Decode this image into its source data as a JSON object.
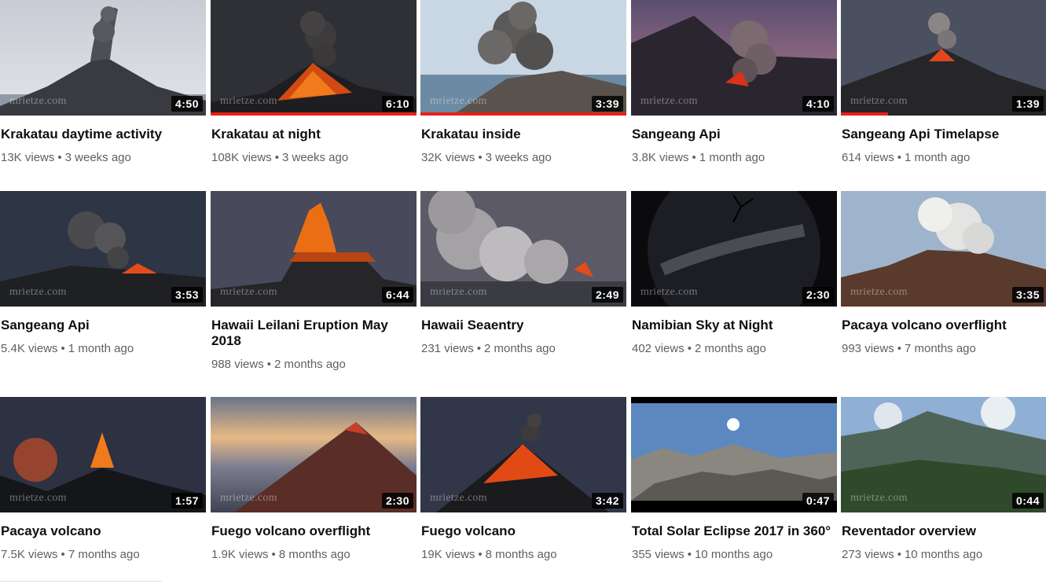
{
  "videos": [
    {
      "title": "Krakatau daytime activity",
      "views": "13K views",
      "age": "3 weeks ago",
      "duration": "4:50",
      "progress": 0,
      "watermark": "mrietze.com"
    },
    {
      "title": "Krakatau at night",
      "views": "108K views",
      "age": "3 weeks ago",
      "duration": "6:10",
      "progress": 1,
      "watermark": "mrietze.com"
    },
    {
      "title": "Krakatau inside",
      "views": "32K views",
      "age": "3 weeks ago",
      "duration": "3:39",
      "progress": 1,
      "watermark": "mrietze.com"
    },
    {
      "title": "Sangeang Api",
      "views": "3.8K views",
      "age": "1 month ago",
      "duration": "4:10",
      "progress": 0,
      "watermark": "mrietze.com"
    },
    {
      "title": "Sangeang Api Timelapse",
      "views": "614 views",
      "age": "1 month ago",
      "duration": "1:39",
      "progress": 0.23,
      "watermark": "mrietze.com"
    },
    {
      "title": "Sangeang Api",
      "views": "5.4K views",
      "age": "1 month ago",
      "duration": "3:53",
      "progress": 0,
      "watermark": "mrietze.com"
    },
    {
      "title": "Hawaii Leilani Eruption May 2018",
      "views": "988 views",
      "age": "2 months ago",
      "duration": "6:44",
      "progress": 0,
      "watermark": "mrietze.com"
    },
    {
      "title": "Hawaii Seaentry",
      "views": "231 views",
      "age": "2 months ago",
      "duration": "2:49",
      "progress": 0,
      "watermark": "mrietze.com"
    },
    {
      "title": "Namibian Sky at Night",
      "views": "402 views",
      "age": "2 months ago",
      "duration": "2:30",
      "progress": 0,
      "watermark": "mrietze.com"
    },
    {
      "title": "Pacaya volcano overflight",
      "views": "993 views",
      "age": "7 months ago",
      "duration": "3:35",
      "progress": 0,
      "watermark": "mrietze.com"
    },
    {
      "title": "Pacaya volcano",
      "views": "7.5K views",
      "age": "7 months ago",
      "duration": "1:57",
      "progress": 0,
      "watermark": "mrietze.com"
    },
    {
      "title": "Fuego volcano overflight",
      "views": "1.9K views",
      "age": "8 months ago",
      "duration": "2:30",
      "progress": 0,
      "watermark": "mrietze.com"
    },
    {
      "title": "Fuego volcano",
      "views": "19K views",
      "age": "8 months ago",
      "duration": "3:42",
      "progress": 0,
      "watermark": "mrietze.com"
    },
    {
      "title": "Total Solar Eclipse 2017 in 360°",
      "views": "355 views",
      "age": "10 months ago",
      "duration": "0:47",
      "progress": 0,
      "watermark": ""
    },
    {
      "title": "Reventador overview",
      "views": "273 views",
      "age": "10 months ago",
      "duration": "0:44",
      "progress": 0,
      "watermark": "mrietze.com"
    }
  ],
  "separator": "•",
  "colors": {
    "progress": "#e62117",
    "meta": "#606060",
    "title": "#0f0f0f"
  }
}
